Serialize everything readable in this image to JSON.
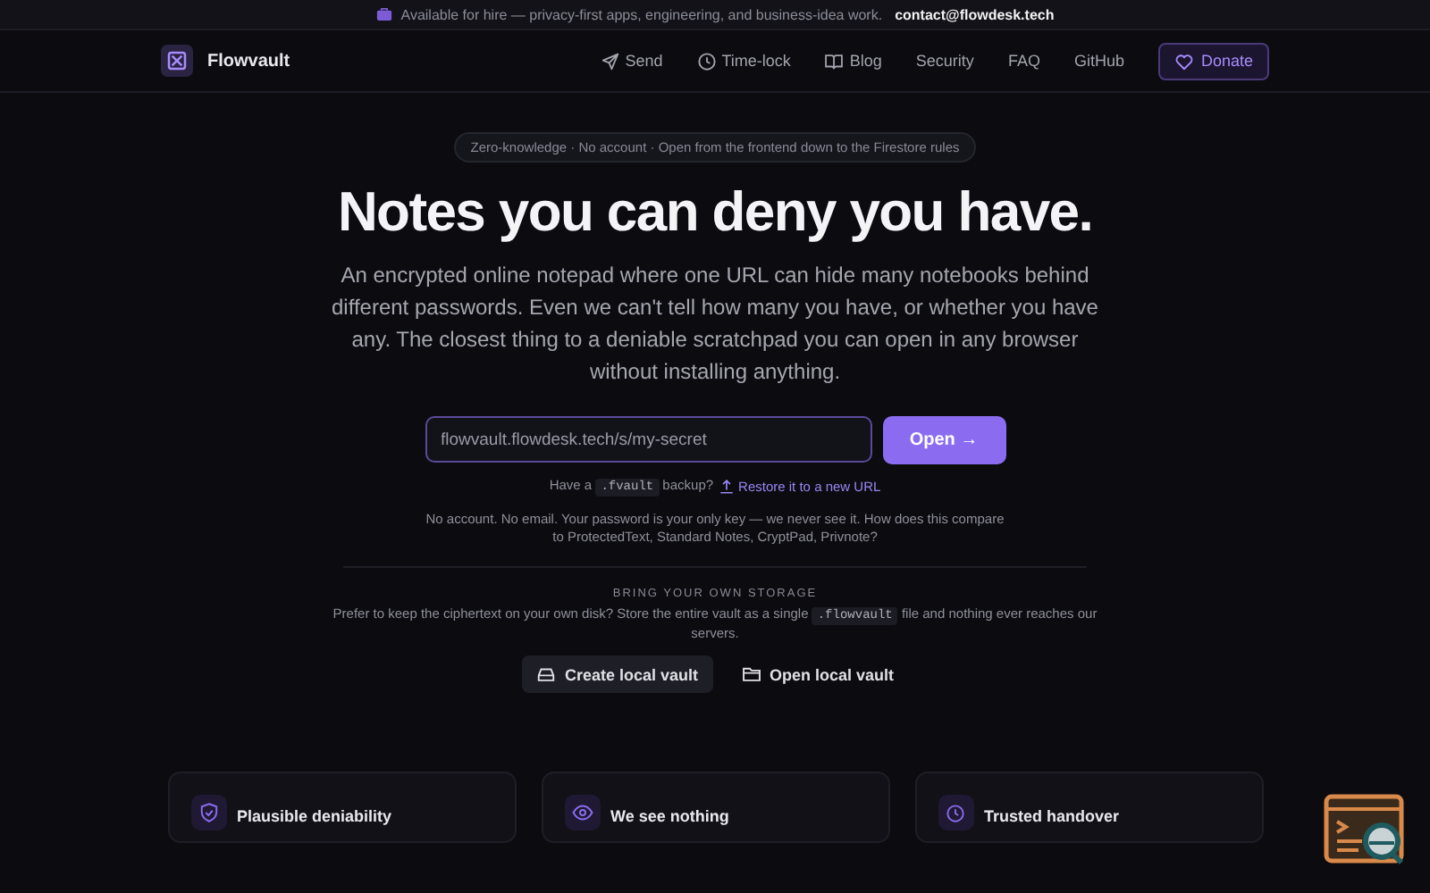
{
  "banner": {
    "text": "Available for hire — privacy-first apps, engineering, and business-idea work.",
    "contact": "contact@flowdesk.tech"
  },
  "nav": {
    "brand": "Flowvault",
    "links": [
      {
        "label": "Send"
      },
      {
        "label": "Time-lock"
      },
      {
        "label": "Blog"
      },
      {
        "label": "Security"
      },
      {
        "label": "FAQ"
      },
      {
        "label": "GitHub"
      }
    ],
    "donate": "Donate"
  },
  "pill": "Zero-knowledge · No account · Open from the frontend down to the Firestore rules",
  "headline": "Notes you can deny you have.",
  "lede": "An encrypted online notepad where one URL can hide many notebooks behind different passwords. Even we can't tell how many you have, or whether you have any. The closest thing to a deniable scratchpad you can open in any browser without installing anything.",
  "url_field": {
    "value": "flowvault.flowdesk.tech/s/my-secret"
  },
  "open_button": "Open →",
  "restore": {
    "before": "Have a",
    "code": ".fvault",
    "after": "backup?",
    "link": "Restore it to a new URL"
  },
  "note": "No account. No email. Your password is your only key — we never see it. How does this compare to ProtectedText, Standard Notes, CryptPad, Privnote?",
  "storage": {
    "heading": "BRING YOUR OWN STORAGE",
    "before": "Prefer to keep the ciphertext on your own disk? Store the entire vault as a single",
    "code": ".flowvault",
    "after": "file and nothing ever reaches our servers.",
    "buttons": [
      {
        "label": "Create local vault",
        "kind": "filled"
      },
      {
        "label": "Open local vault",
        "kind": "plain"
      }
    ]
  },
  "cards": [
    {
      "title": "Plausible deniability"
    },
    {
      "title": "We see nothing"
    },
    {
      "title": "Trusted handover"
    }
  ]
}
